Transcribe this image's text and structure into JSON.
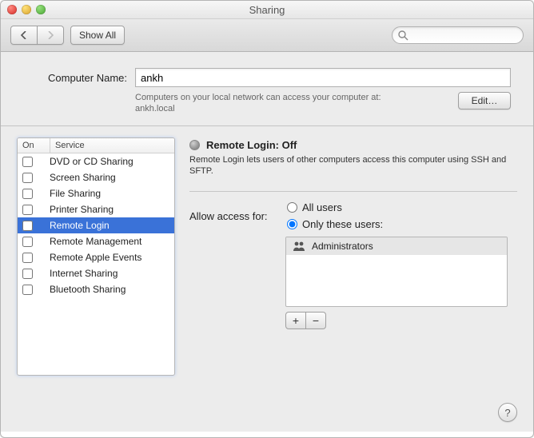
{
  "window": {
    "title": "Sharing"
  },
  "toolbar": {
    "show_all_label": "Show All",
    "search_placeholder": ""
  },
  "header": {
    "computer_name_label": "Computer Name:",
    "computer_name_value": "ankh",
    "hint_line1": "Computers on your local network can access your computer at:",
    "hint_line2": "ankh.local",
    "edit_label": "Edit…"
  },
  "services": {
    "col_on": "On",
    "col_service": "Service",
    "items": [
      {
        "label": "DVD or CD Sharing",
        "on": false,
        "selected": false
      },
      {
        "label": "Screen Sharing",
        "on": false,
        "selected": false
      },
      {
        "label": "File Sharing",
        "on": false,
        "selected": false
      },
      {
        "label": "Printer Sharing",
        "on": false,
        "selected": false
      },
      {
        "label": "Remote Login",
        "on": false,
        "selected": true
      },
      {
        "label": "Remote Management",
        "on": false,
        "selected": false
      },
      {
        "label": "Remote Apple Events",
        "on": false,
        "selected": false
      },
      {
        "label": "Internet Sharing",
        "on": false,
        "selected": false
      },
      {
        "label": "Bluetooth Sharing",
        "on": false,
        "selected": false
      }
    ]
  },
  "detail": {
    "status_title": "Remote Login: Off",
    "description": "Remote Login lets users of other computers access this computer using SSH and SFTP.",
    "access_label": "Allow access for:",
    "all_users_label": "All users",
    "only_these_label": "Only these users:",
    "access_mode": "only",
    "users": [
      "Administrators"
    ],
    "plus": "+",
    "minus": "−",
    "help": "?"
  }
}
